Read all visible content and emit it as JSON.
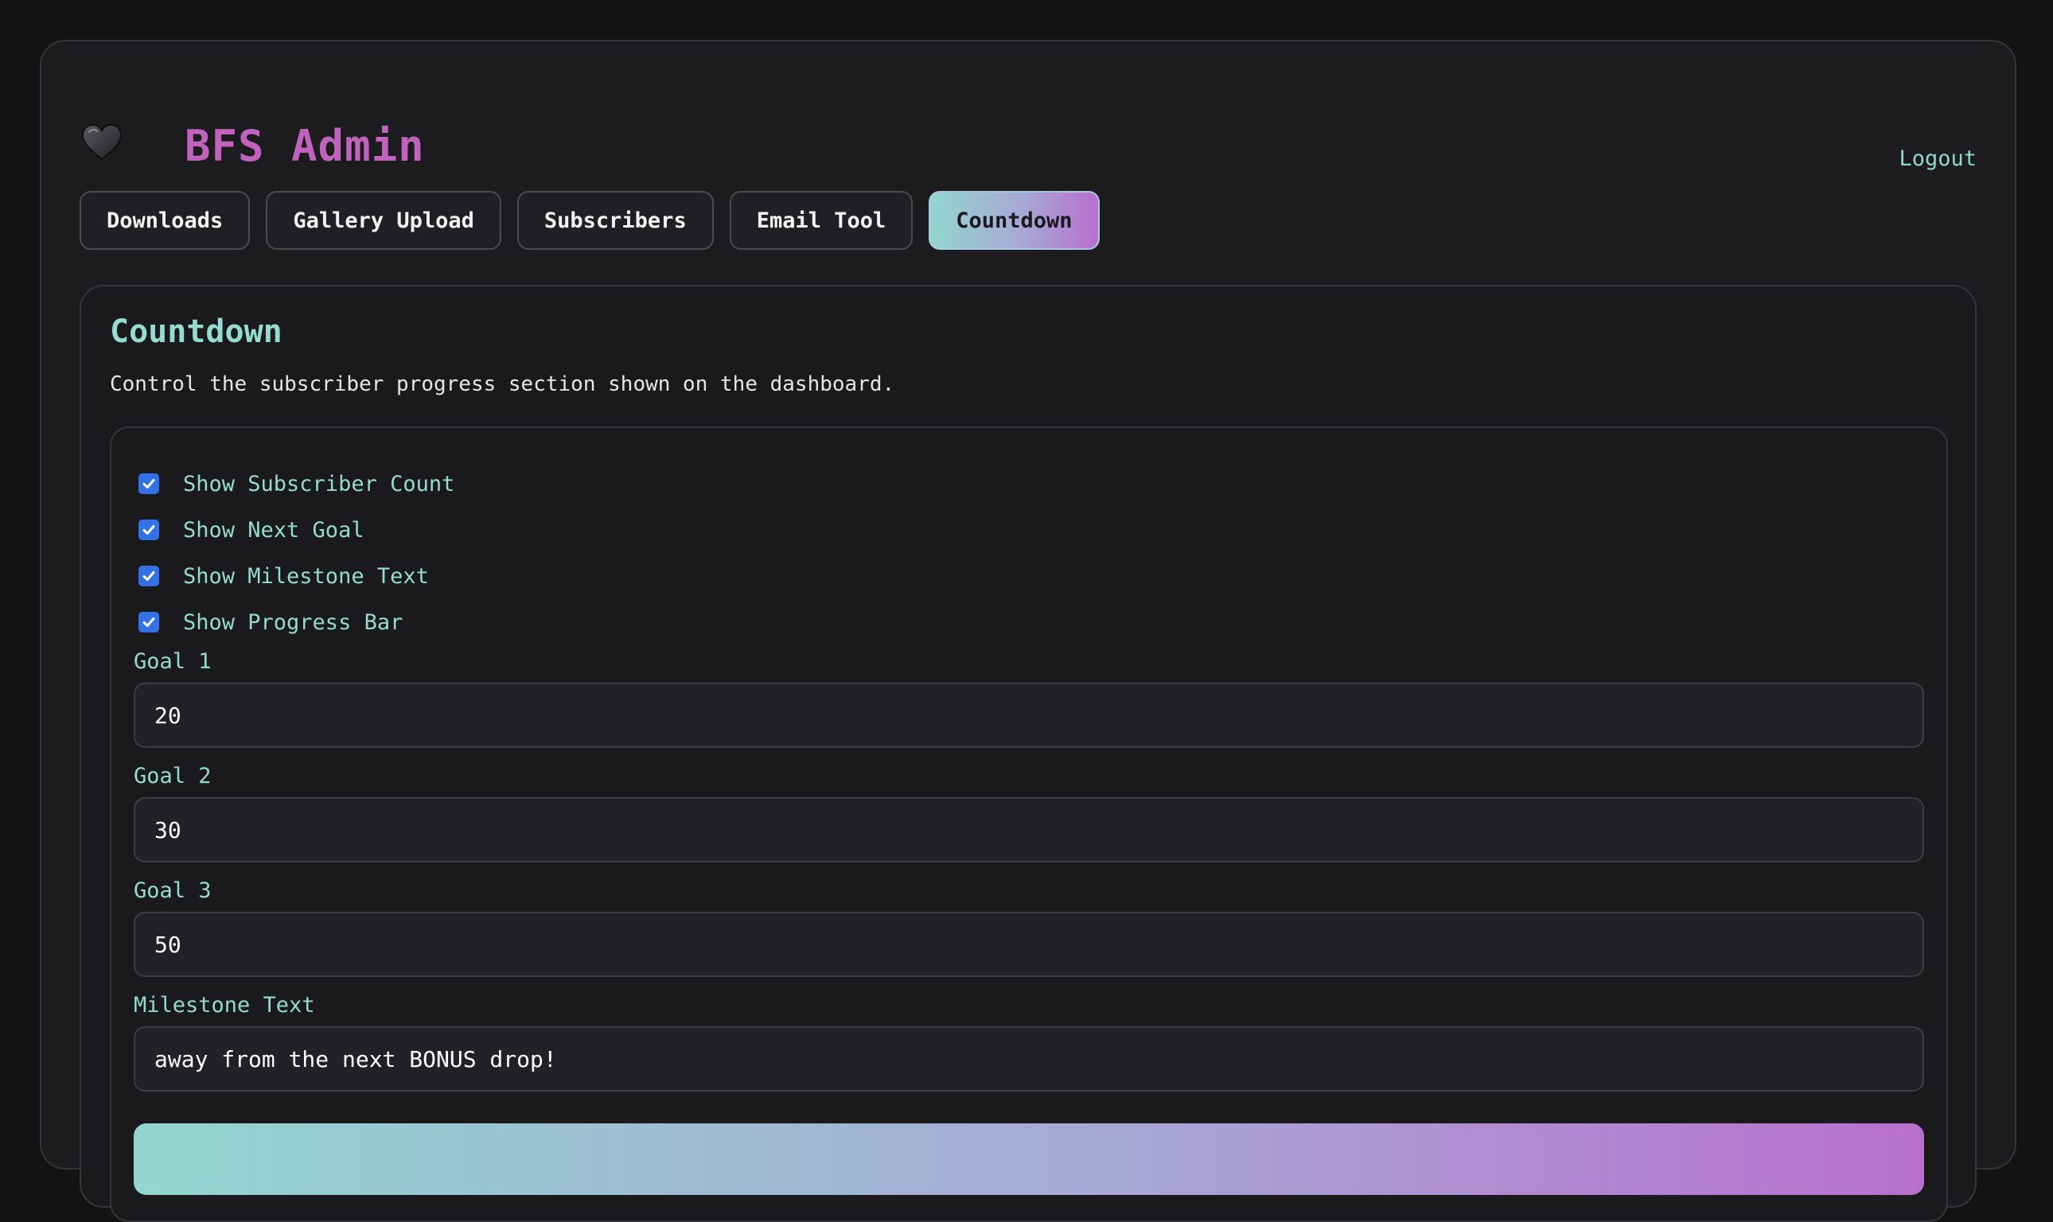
{
  "app": {
    "title": "BFS Admin",
    "logo_icon": "heart-icon",
    "logout_label": "Logout"
  },
  "tabs": [
    {
      "label": "Downloads",
      "active": false
    },
    {
      "label": "Gallery Upload",
      "active": false
    },
    {
      "label": "Subscribers",
      "active": false
    },
    {
      "label": "Email Tool",
      "active": false
    },
    {
      "label": "Countdown",
      "active": true
    }
  ],
  "section": {
    "title": "Countdown",
    "description": "Control the subscriber progress section shown on the dashboard."
  },
  "options": [
    {
      "label": "Show Subscriber Count",
      "checked": true
    },
    {
      "label": "Show Next Goal",
      "checked": true
    },
    {
      "label": "Show Milestone Text",
      "checked": true
    },
    {
      "label": "Show Progress Bar",
      "checked": true
    }
  ],
  "fields": [
    {
      "label": "Goal 1",
      "value": "20"
    },
    {
      "label": "Goal 2",
      "value": "30"
    },
    {
      "label": "Goal 3",
      "value": "50"
    },
    {
      "label": "Milestone Text",
      "value": "away from the next BONUS drop!"
    }
  ],
  "colors": {
    "brand": "#c063bd",
    "accent": "#95dbd2",
    "checkbox": "#3372e6",
    "gradient_start": "#93d6cf",
    "gradient_end": "#b870cf"
  }
}
